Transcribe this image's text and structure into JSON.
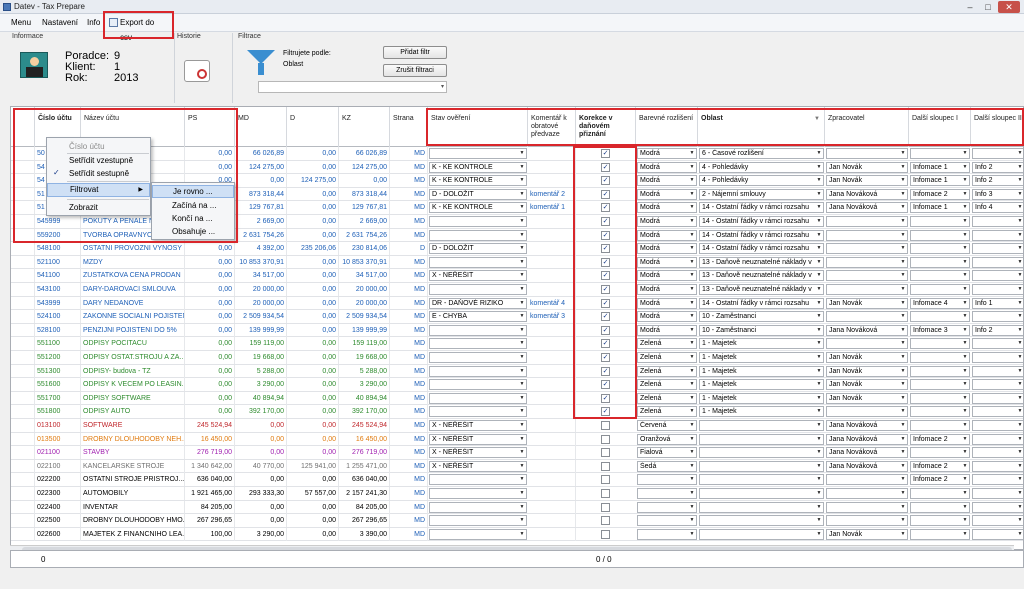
{
  "window": {
    "title": "Datev - Tax Prepare"
  },
  "menu": {
    "items": [
      "Menu",
      "Nastavení",
      "Info"
    ],
    "export_label": "Export do csv"
  },
  "info": {
    "title": "Informace",
    "poradce_label": "Poradce:",
    "poradce": "9",
    "klient_label": "Klient:",
    "klient": "1",
    "rok_label": "Rok:",
    "rok": "2013"
  },
  "historie": {
    "title": "Historie"
  },
  "filtrace": {
    "title": "Filtrace",
    "filter_by_label": "Filtrujete podle:",
    "filter_value": "Oblast",
    "add_filter": "Přidat filtr",
    "cancel_filter": "Zrušit filtraci"
  },
  "columns": {
    "cislo": "Číslo účtu",
    "nazev": "Název účtu",
    "ps": "PS",
    "md": "MD",
    "d": "D",
    "kz": "KZ",
    "strana": "Strana",
    "stav": "Stav ověření",
    "komentar": "Komentář k obratové předvaze",
    "korekce": "Korekce v daňovém přiznání",
    "barevne": "Barevné rozlišení",
    "oblast": "Oblast",
    "zpracovatel": "Zpracovatel",
    "dalsi1": "Další sloupec I",
    "dalsi2": "Další sloupec II"
  },
  "context_menu": {
    "items": [
      "Číslo účtu",
      "Setřídit vzestupně",
      "Setřídit sestupně",
      "Filtrovat",
      "Zobrazit"
    ],
    "submenu": [
      "Je rovno ...",
      "Začíná na ...",
      "Končí na ...",
      "Obsahuje ..."
    ]
  },
  "rows": [
    {
      "cislo": "50",
      "nazev": "ONE",
      "ps": "0,00",
      "md": "66 026,89",
      "d": "0,00",
      "kz": "66 026,89",
      "strana": "MD",
      "stav": "",
      "kom": "",
      "kor": true,
      "bar": "Modrá",
      "obl": "6 - Časové rozlišení",
      "zpr": "",
      "d1": "",
      "d2": "",
      "color": "#1d5fb7"
    },
    {
      "cislo": "54",
      "nazev": "DANOVY",
      "ps": "0,00",
      "md": "124 275,00",
      "d": "0,00",
      "kz": "124 275,00",
      "strana": "MD",
      "stav": "K - KE KONTROLE",
      "kom": "",
      "kor": true,
      "bar": "Modrá",
      "obl": "4 - Pohledávky",
      "zpr": "Jan Novák",
      "d1": "Infomace 1",
      "d2": "Info 2",
      "color": "#1d5fb7"
    },
    {
      "cislo": "54",
      "nazev": "hledávek",
      "ps": "0,00",
      "md": "0,00",
      "d": "124 275,00",
      "kz": "0,00",
      "strana": "MD",
      "stav": "K - KE KONTROLE",
      "kom": "",
      "kor": true,
      "bar": "Modrá",
      "obl": "4 - Pohledávky",
      "zpr": "Jan Novák",
      "d1": "Infomace 1",
      "d2": "Info 2",
      "color": "#1d5fb7"
    },
    {
      "cislo": "51",
      "nazev": "",
      "ps": "0,00",
      "md": "873 318,44",
      "d": "0,00",
      "kz": "873 318,44",
      "strana": "MD",
      "stav": "D - DOLOŽIT",
      "kom": "komentář 2",
      "kor": true,
      "bar": "Modrá",
      "obl": "2 - Nájemní smlouvy",
      "zpr": "Jana Nováková",
      "d1": "Infomace 2",
      "d2": "Info 3",
      "color": "#1d5fb7"
    },
    {
      "cislo": "51",
      "nazev": "",
      "ps": "0,00",
      "md": "129 767,81",
      "d": "0,00",
      "kz": "129 767,81",
      "strana": "MD",
      "stav": "K - KE KONTROLE",
      "kom": "komentář 1",
      "kor": true,
      "bar": "Modrá",
      "obl": "14 - Ostatní řádky v rámci rozsahu",
      "zpr": "Jana Nováková",
      "d1": "Infomace 1",
      "d2": "Info 4",
      "color": "#1d5fb7"
    },
    {
      "cislo": "545999",
      "nazev": "POKUTY A PENALE NA",
      "ps": "0,00",
      "md": "2 669,00",
      "d": "0,00",
      "kz": "2 669,00",
      "strana": "MD",
      "stav": "",
      "kom": "",
      "kor": true,
      "bar": "Modrá",
      "obl": "14 - Ostatní řádky v rámci rozsahu",
      "zpr": "",
      "d1": "",
      "d2": "",
      "color": "#1d5fb7"
    },
    {
      "cislo": "559200",
      "nazev": "TVORBA OPRAVNYCH",
      "ps": "0,00",
      "md": "2 631 754,26",
      "d": "0,00",
      "kz": "2 631 754,26",
      "strana": "MD",
      "stav": "",
      "kom": "",
      "kor": true,
      "bar": "Modrá",
      "obl": "14 - Ostatní řádky v rámci rozsahu",
      "zpr": "",
      "d1": "",
      "d2": "",
      "color": "#1d5fb7"
    },
    {
      "cislo": "548100",
      "nazev": "OSTATNI PROVOZNI VYNOSY",
      "ps": "0,00",
      "md": "4 392,00",
      "d": "235 206,06",
      "kz": "230 814,06",
      "strana": "D",
      "stav": "D - DOLOŽIT",
      "kom": "",
      "kor": true,
      "bar": "Modrá",
      "obl": "14 - Ostatní řádky v rámci rozsahu",
      "zpr": "",
      "d1": "",
      "d2": "",
      "color": "#1d5fb7"
    },
    {
      "cislo": "521100",
      "nazev": "MZDY",
      "ps": "0,00",
      "md": "10 853 370,91",
      "d": "0,00",
      "kz": "10 853 370,91",
      "strana": "MD",
      "stav": "",
      "kom": "",
      "kor": true,
      "bar": "Modrá",
      "obl": "13 - Daňově neuznatelné náklady v",
      "zpr": "",
      "d1": "",
      "d2": "",
      "color": "#1d5fb7"
    },
    {
      "cislo": "541100",
      "nazev": "ZUSTATKOVA CENA PRODAN",
      "ps": "0,00",
      "md": "34 517,00",
      "d": "0,00",
      "kz": "34 517,00",
      "strana": "MD",
      "stav": "X - NEŘEŠIT",
      "kom": "",
      "kor": true,
      "bar": "Modrá",
      "obl": "13 - Daňově neuznatelné náklady v",
      "zpr": "",
      "d1": "",
      "d2": "",
      "color": "#1d5fb7"
    },
    {
      "cislo": "543100",
      "nazev": "DARY-DAROVACI SMLOUVA",
      "ps": "0,00",
      "md": "20 000,00",
      "d": "0,00",
      "kz": "20 000,00",
      "strana": "MD",
      "stav": "",
      "kom": "",
      "kor": true,
      "bar": "Modrá",
      "obl": "13 - Daňově neuznatelné náklady v",
      "zpr": "",
      "d1": "",
      "d2": "",
      "color": "#1d5fb7"
    },
    {
      "cislo": "543999",
      "nazev": "DARY NEDANOVE",
      "ps": "0,00",
      "md": "20 000,00",
      "d": "0,00",
      "kz": "20 000,00",
      "strana": "MD",
      "stav": "DR - DAŇOVÉ RIZIKO",
      "kom": "komentář 4",
      "kor": true,
      "bar": "Modrá",
      "obl": "14 - Ostatní řádky v rámci rozsahu",
      "zpr": "Jan Novák",
      "d1": "Infomace 4",
      "d2": "Info 1",
      "color": "#1d5fb7"
    },
    {
      "cislo": "524100",
      "nazev": "ZAKONNE SOCIALNI POJISTENI",
      "ps": "0,00",
      "md": "2 509 934,54",
      "d": "0,00",
      "kz": "2 509 934,54",
      "strana": "MD",
      "stav": "E - CHYBA",
      "kom": "komentář 3",
      "kor": true,
      "bar": "Modrá",
      "obl": "10 - Zaměstnanci",
      "zpr": "",
      "d1": "",
      "d2": "",
      "color": "#1d5fb7"
    },
    {
      "cislo": "528100",
      "nazev": "PENZIJNI POJISTENI DO 5%",
      "ps": "0,00",
      "md": "139 999,99",
      "d": "0,00",
      "kz": "139 999,99",
      "strana": "MD",
      "stav": "",
      "kom": "",
      "kor": true,
      "bar": "Modrá",
      "obl": "10 - Zaměstnanci",
      "zpr": "Jana Nováková",
      "d1": "Infomace 3",
      "d2": "Info 2",
      "color": "#1d5fb7"
    },
    {
      "cislo": "551100",
      "nazev": "ODPISY POCITACU",
      "ps": "0,00",
      "md": "159 119,00",
      "d": "0,00",
      "kz": "159 119,00",
      "strana": "MD",
      "stav": "",
      "kom": "",
      "kor": true,
      "bar": "Zelená",
      "obl": "1 - Majetek",
      "zpr": "",
      "d1": "",
      "d2": "",
      "color": "#2e8b2e"
    },
    {
      "cislo": "551200",
      "nazev": "ODPISY OSTAT.STROJU A ZA..",
      "ps": "0,00",
      "md": "19 668,00",
      "d": "0,00",
      "kz": "19 668,00",
      "strana": "MD",
      "stav": "",
      "kom": "",
      "kor": true,
      "bar": "Zelená",
      "obl": "1 - Majetek",
      "zpr": "Jan Novák",
      "d1": "",
      "d2": "",
      "color": "#2e8b2e"
    },
    {
      "cislo": "551300",
      "nazev": "ODPISY- budova - TZ",
      "ps": "0,00",
      "md": "5 288,00",
      "d": "0,00",
      "kz": "5 288,00",
      "strana": "MD",
      "stav": "",
      "kom": "",
      "kor": true,
      "bar": "Zelená",
      "obl": "1 - Majetek",
      "zpr": "Jan Novák",
      "d1": "",
      "d2": "",
      "color": "#2e8b2e"
    },
    {
      "cislo": "551600",
      "nazev": "ODPISY K VECEM PO LEASIN..",
      "ps": "0,00",
      "md": "3 290,00",
      "d": "0,00",
      "kz": "3 290,00",
      "strana": "MD",
      "stav": "",
      "kom": "",
      "kor": true,
      "bar": "Zelená",
      "obl": "1 - Majetek",
      "zpr": "Jan Novák",
      "d1": "",
      "d2": "",
      "color": "#2e8b2e"
    },
    {
      "cislo": "551700",
      "nazev": "ODPISY SOFTWARE",
      "ps": "0,00",
      "md": "40 894,94",
      "d": "0,00",
      "kz": "40 894,94",
      "strana": "MD",
      "stav": "",
      "kom": "",
      "kor": true,
      "bar": "Zelená",
      "obl": "1 - Majetek",
      "zpr": "Jan Novák",
      "d1": "",
      "d2": "",
      "color": "#2e8b2e"
    },
    {
      "cislo": "551800",
      "nazev": "ODPISY AUTO",
      "ps": "0,00",
      "md": "392 170,00",
      "d": "0,00",
      "kz": "392 170,00",
      "strana": "MD",
      "stav": "",
      "kom": "",
      "kor": true,
      "bar": "Zelená",
      "obl": "1 - Majetek",
      "zpr": "",
      "d1": "",
      "d2": "",
      "color": "#2e8b2e"
    },
    {
      "cislo": "013100",
      "nazev": "SOFTWARE",
      "ps": "245 524,94",
      "md": "0,00",
      "d": "0,00",
      "kz": "245 524,94",
      "strana": "MD",
      "stav": "X - NEŘEŠIT",
      "kom": "",
      "kor": false,
      "bar": "Červená",
      "obl": "",
      "zpr": "Jana Nováková",
      "d1": "",
      "d2": "",
      "color": "#c0282d"
    },
    {
      "cislo": "013500",
      "nazev": "DROBNY DLOUHODOBY NEH...",
      "ps": "16 450,00",
      "md": "0,00",
      "d": "0,00",
      "kz": "16 450,00",
      "strana": "MD",
      "stav": "X - NEŘEŠIT",
      "kom": "",
      "kor": false,
      "bar": "Oranžová",
      "obl": "",
      "zpr": "Jana Nováková",
      "d1": "Infomace 2",
      "d2": "",
      "color": "#e07b10"
    },
    {
      "cislo": "021100",
      "nazev": "STAVBY",
      "ps": "276 719,00",
      "md": "0,00",
      "d": "0,00",
      "kz": "276 719,00",
      "strana": "MD",
      "stav": "X - NEŘEŠIT",
      "kom": "",
      "kor": false,
      "bar": "Fialová",
      "obl": "",
      "zpr": "Jana Nováková",
      "d1": "",
      "d2": "",
      "color": "#a01fb0"
    },
    {
      "cislo": "022100",
      "nazev": "KANCELARSKE STROJE",
      "ps": "1 340 642,00",
      "md": "40 770,00",
      "d": "125 941,00",
      "kz": "1 255 471,00",
      "strana": "MD",
      "stav": "X - NEŘEŠIT",
      "kom": "",
      "kor": false,
      "bar": "Šedá",
      "obl": "",
      "zpr": "Jana Nováková",
      "d1": "Infomace 2",
      "d2": "",
      "color": "#707070"
    },
    {
      "cislo": "022200",
      "nazev": "OSTATNI STROJE PRISTROJ...",
      "ps": "636 040,00",
      "md": "0,00",
      "d": "0,00",
      "kz": "636 040,00",
      "strana": "MD",
      "stav": "",
      "kom": "",
      "kor": false,
      "bar": "",
      "obl": "",
      "zpr": "",
      "d1": "Infomace 2",
      "d2": "",
      "color": "#000000"
    },
    {
      "cislo": "022300",
      "nazev": "AUTOMOBILY",
      "ps": "1 921 465,00",
      "md": "293 333,30",
      "d": "57 557,00",
      "kz": "2 157 241,30",
      "strana": "MD",
      "stav": "",
      "kom": "",
      "kor": false,
      "bar": "",
      "obl": "",
      "zpr": "",
      "d1": "",
      "d2": "",
      "color": "#000000"
    },
    {
      "cislo": "022400",
      "nazev": "INVENTAR",
      "ps": "84 205,00",
      "md": "0,00",
      "d": "0,00",
      "kz": "84 205,00",
      "strana": "MD",
      "stav": "",
      "kom": "",
      "kor": false,
      "bar": "",
      "obl": "",
      "zpr": "",
      "d1": "",
      "d2": "",
      "color": "#000000"
    },
    {
      "cislo": "022500",
      "nazev": "DROBNY DLOUHODOBY HMO...",
      "ps": "267 296,65",
      "md": "0,00",
      "d": "0,00",
      "kz": "267 296,65",
      "strana": "MD",
      "stav": "",
      "kom": "",
      "kor": false,
      "bar": "",
      "obl": "",
      "zpr": "",
      "d1": "",
      "d2": "",
      "color": "#000000"
    },
    {
      "cislo": "022600",
      "nazev": "MAJETEK Z FINANCNIHO LEA...",
      "ps": "100,00",
      "md": "3 290,00",
      "d": "0,00",
      "kz": "3 390,00",
      "strana": "MD",
      "stav": "",
      "kom": "",
      "kor": false,
      "bar": "",
      "obl": "",
      "zpr": "Jan Novák",
      "d1": "",
      "d2": "",
      "color": "#000000"
    }
  ],
  "footer": {
    "count": "0",
    "korekce_count": "0 / 0"
  }
}
